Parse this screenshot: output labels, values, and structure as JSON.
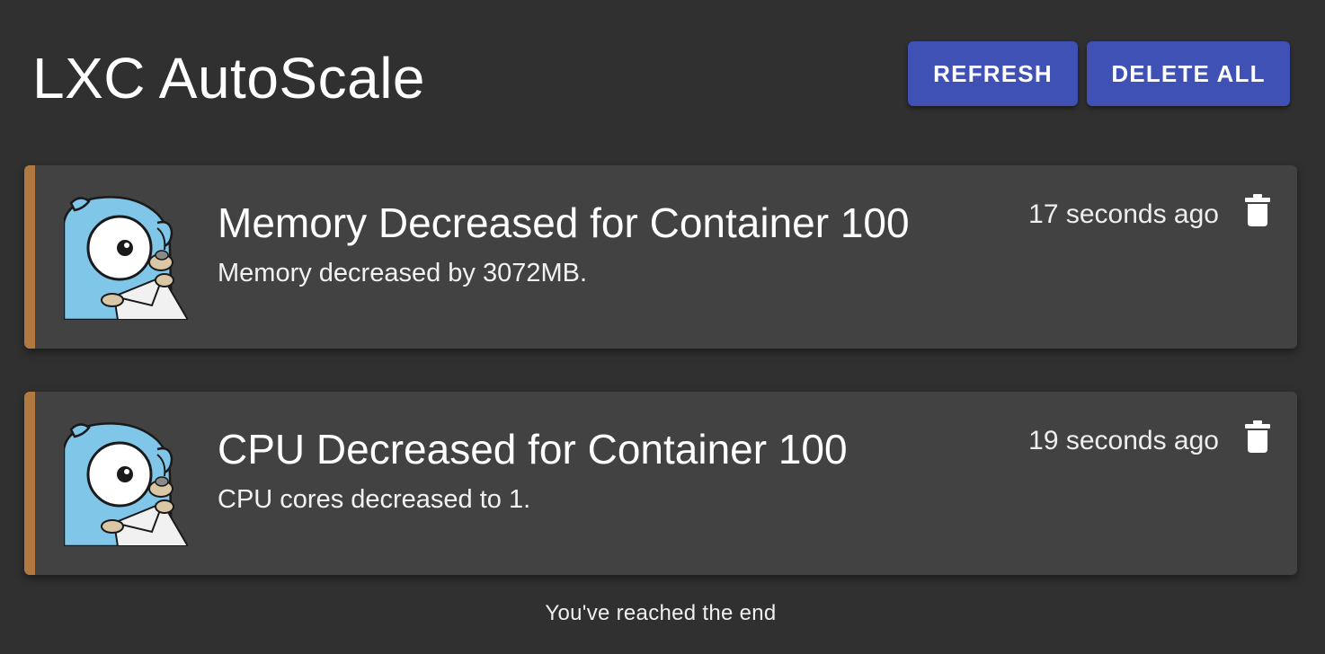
{
  "header": {
    "title": "LXC AutoScale",
    "refresh_label": "REFRESH",
    "delete_all_label": "DELETE ALL"
  },
  "notifications": [
    {
      "title": "Memory Decreased for Container 100",
      "message": "Memory decreased by 3072MB.",
      "time": "17 seconds ago",
      "avatar_icon": "gopher-mascot-icon",
      "delete_icon": "trash-icon"
    },
    {
      "title": "CPU Decreased for Container 100",
      "message": "CPU cores decreased to 1.",
      "time": "19 seconds ago",
      "avatar_icon": "gopher-mascot-icon",
      "delete_icon": "trash-icon"
    }
  ],
  "footer": {
    "end_message": "You've reached the end"
  },
  "colors": {
    "background": "#303030",
    "card": "#424242",
    "card_accent": "#b17842",
    "button": "#3f51b5",
    "gopher": "#7fc6e8"
  }
}
